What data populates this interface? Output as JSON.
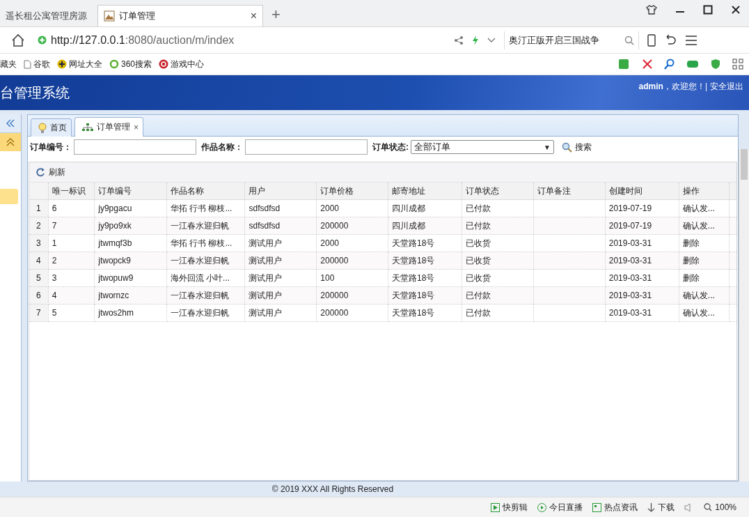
{
  "browser": {
    "tabs": [
      {
        "title": "遥长租公寓管理房源",
        "selected": false
      },
      {
        "title": "订单管理",
        "selected": true,
        "close": "×"
      }
    ],
    "new_tab": "+",
    "url_host": "http://127.0.0.1",
    "url_path": ":8080/auction/m/index",
    "address_search": "奥汀正版开启三国战争",
    "bookmarks": [
      "藏夹",
      "谷歌",
      "网址大全",
      "360搜索",
      "游戏中心"
    ],
    "status_items": [
      "快剪辑",
      "今日直播",
      "热点资讯",
      "下载"
    ],
    "zoom": "100%"
  },
  "app": {
    "title": "台管理系统",
    "user": "admin",
    "greeting": "，欢迎您！",
    "separator": "|",
    "logout": "安全退出"
  },
  "page_tabs": [
    {
      "label": "首页",
      "selected": false
    },
    {
      "label": "订单管理",
      "selected": true,
      "close": "×"
    }
  ],
  "filters": [
    {
      "kind": "text",
      "label": "订单编号："
    },
    {
      "kind": "text",
      "label": "作品名称："
    },
    {
      "kind": "select",
      "label": "订单状态:",
      "value": "全部订单",
      "caret": "▼"
    }
  ],
  "search_button": "搜索",
  "refresh_button": "刷新",
  "table": {
    "columns": [
      "唯一标识",
      "订单编号",
      "作品名称",
      "用户",
      "订单价格",
      "邮寄地址",
      "订单状态",
      "订单备注",
      "创建时间",
      "操作"
    ],
    "rows": [
      {
        "num": "1",
        "cells": [
          "6",
          "jy9pgacu",
          "华拓 行书 柳枝...",
          "sdfsdfsd",
          "2000",
          "四川成都",
          "已付款",
          "",
          "2019-07-19",
          "确认发..."
        ]
      },
      {
        "num": "2",
        "cells": [
          "7",
          "jy9po9xk",
          "一江春水迎归帆",
          "sdfsdfsd",
          "200000",
          "四川成都",
          "已付款",
          "",
          "2019-07-19",
          "确认发..."
        ]
      },
      {
        "num": "3",
        "cells": [
          "1",
          "jtwmqf3b",
          "华拓 行书 柳枝...",
          "测试用户",
          "2000",
          "天堂路18号",
          "已收货",
          "",
          "2019-03-31",
          "删除"
        ]
      },
      {
        "num": "4",
        "cells": [
          "2",
          "jtwopck9",
          "一江春水迎归帆",
          "测试用户",
          "200000",
          "天堂路18号",
          "已收货",
          "",
          "2019-03-31",
          "删除"
        ]
      },
      {
        "num": "5",
        "cells": [
          "3",
          "jtwopuw9",
          "海外回流 小叶...",
          "测试用户",
          "100",
          "天堂路18号",
          "已收货",
          "",
          "2019-03-31",
          "删除"
        ]
      },
      {
        "num": "6",
        "cells": [
          "4",
          "jtwornzc",
          "一江春水迎归帆",
          "测试用户",
          "200000",
          "天堂路18号",
          "已付款",
          "",
          "2019-03-31",
          "确认发..."
        ]
      },
      {
        "num": "7",
        "cells": [
          "5",
          "jtwos2hm",
          "一江春水迎归帆",
          "测试用户",
          "200000",
          "天堂路18号",
          "已付款",
          "",
          "2019-03-31",
          "确认发..."
        ]
      }
    ]
  },
  "footer": "© 2019 XXX All Rights Reserved"
}
